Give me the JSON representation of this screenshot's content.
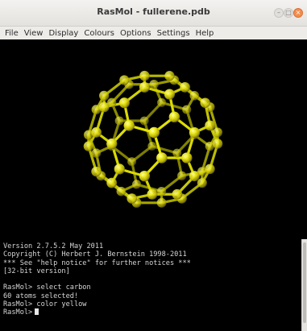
{
  "window": {
    "title": "RasMol - fullerene.pdb",
    "controls": {
      "minimize_icon": "minimize-icon",
      "maximize_icon": "maximize-icon",
      "close_icon": "close-icon"
    }
  },
  "menu": {
    "items": [
      {
        "label": "File"
      },
      {
        "label": "View"
      },
      {
        "label": "Display"
      },
      {
        "label": "Colours"
      },
      {
        "label": "Options"
      },
      {
        "label": "Settings"
      },
      {
        "label": "Help"
      }
    ]
  },
  "viewer": {
    "background_color": "#000000",
    "molecule": "fullerene",
    "atom_color": "#e6e100"
  },
  "console": {
    "lines": [
      "Version 2.7.5.2 May 2011",
      "Copyright (C) Herbert J. Bernstein 1998-2011",
      "*** See \"help notice\" for further notices ***",
      "[32-bit version]",
      "",
      "RasMol> select carbon",
      "60 atoms selected!",
      "RasMol> color yellow",
      "RasMol>"
    ]
  }
}
